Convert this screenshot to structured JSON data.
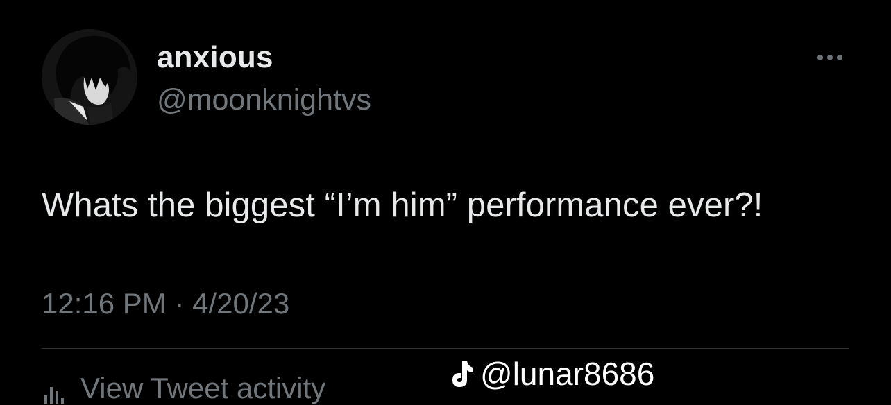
{
  "tweet": {
    "author": {
      "display_name": "anxious",
      "handle": "@moonknightvs",
      "avatar_icon": "avatar-image"
    },
    "more_icon": "more-options-icon",
    "text": "Whats the biggest “I’m him” performance ever?!",
    "timestamp": "12:16 PM · 4/20/23",
    "activity_label": "View Tweet activity",
    "activity_icon": "bar-chart-icon"
  },
  "watermark": {
    "icon": "tiktok-icon",
    "text": "@lunar8686"
  },
  "colors": {
    "background": "#000000",
    "primary_text": "#e7e9ea",
    "secondary_text": "#71767b",
    "divider": "#2f3336"
  }
}
